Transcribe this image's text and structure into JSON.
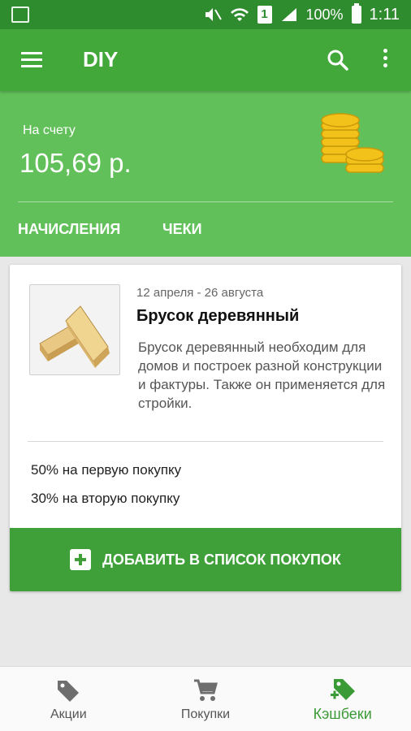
{
  "status_bar": {
    "battery": "100%",
    "time": "1:11",
    "sim_slot": "1"
  },
  "app_bar": {
    "title": "DIY"
  },
  "account": {
    "balance_label": "На счету",
    "balance_value": "105,69 р.",
    "tabs": [
      "НАЧИСЛЕНИЯ",
      "ЧЕКИ"
    ]
  },
  "offer_card": {
    "date_range": "12 апреля - 26 августа",
    "title": "Брусок деревянный",
    "description": "Брусок деревянный необходим для домов и построек разной конструкции и фактуры. Также он применяется для стройки.",
    "offers": [
      "50% на первую покупку",
      "30% на вторую покупку"
    ],
    "add_button_label": "ДОБАВИТЬ В СПИСОК ПОКУПОК"
  },
  "bottom_nav": {
    "items": [
      {
        "label": "Акции",
        "icon": "tag-icon",
        "active": false
      },
      {
        "label": "Покупки",
        "icon": "cart-icon",
        "active": false
      },
      {
        "label": "Кэшбеки",
        "icon": "cashback-tag-icon",
        "active": true
      }
    ]
  },
  "colors": {
    "status_bar": "#2e8b2e",
    "app_bar": "#43a83a",
    "hero": "#62c05a",
    "button": "#3fa03a",
    "active_nav": "#3a9a35"
  }
}
